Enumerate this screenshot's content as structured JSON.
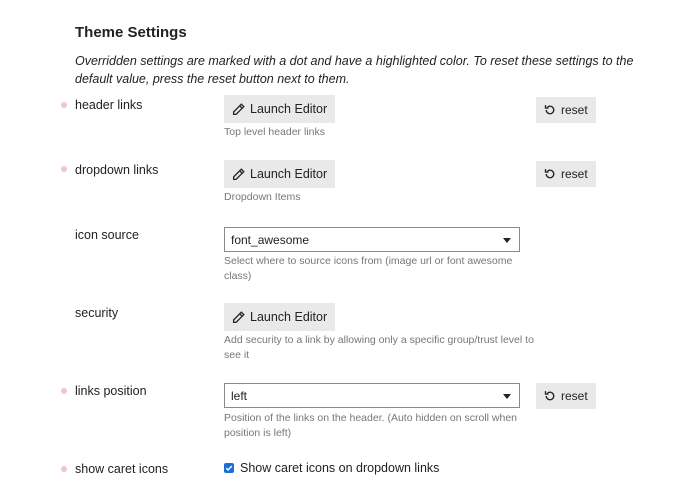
{
  "section": {
    "title": "Theme Settings",
    "description": "Overridden settings are marked with a dot and have a highlighted color. To reset these settings to the default value, press the reset button next to them."
  },
  "colors": {
    "dot": "#f1c6c6",
    "checkbox": "#1a6ed8",
    "button_bg": "#e9e9e9",
    "help_text": "#777777"
  },
  "settings": {
    "header_links": {
      "label": "header links",
      "button": "Launch Editor",
      "help": "Top level header links",
      "reset": "reset"
    },
    "dropdown_links": {
      "label": "dropdown links",
      "button": "Launch Editor",
      "help": "Dropdown Items",
      "reset": "reset"
    },
    "icon_source": {
      "label": "icon source",
      "value": "font_awesome",
      "help1": "Select where to source icons from (image url or font awesome",
      "help2": "class)"
    },
    "security": {
      "label": "security",
      "button": "Launch Editor",
      "help1": "Add security to a link by allowing only a specific group/trust level to",
      "help2": "see it"
    },
    "links_position": {
      "label": "links position",
      "value": "left",
      "help1": "Position of the links on the header. (Auto hidden on scroll when",
      "help2": "position is left)",
      "reset": "reset"
    },
    "show_caret_icons": {
      "label": "show caret icons",
      "checkbox_label": "Show caret icons on dropdown links",
      "checked": true
    }
  }
}
